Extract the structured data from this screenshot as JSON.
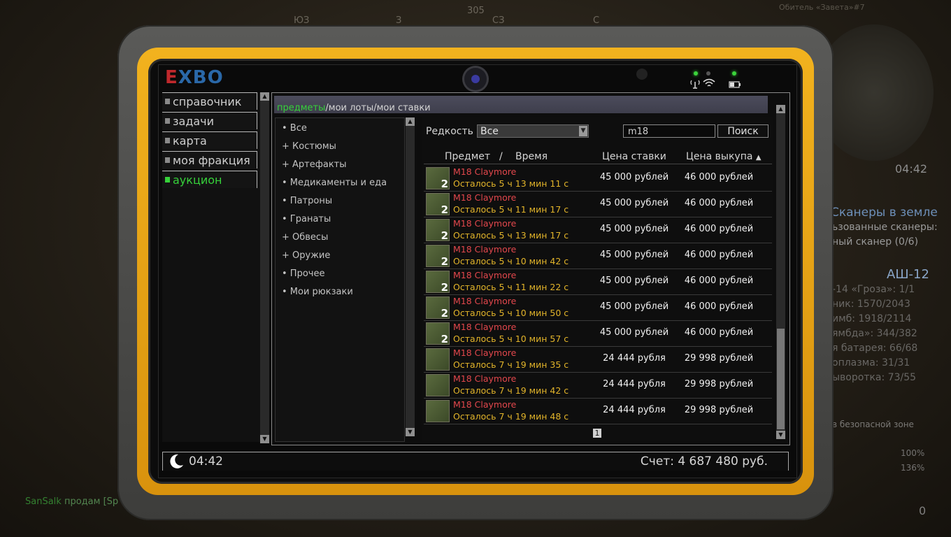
{
  "background": {
    "compass_marks": [
      "ЮЗ",
      "305",
      "З",
      "СЗ",
      "С"
    ],
    "location": "Обитель «Завета»#7",
    "hud_time": "04:42",
    "hud_quest_title": "Сканеры в земле",
    "hud_quest_lines": [
      "ьзованные сканеры:",
      "ный сканер (0/6)"
    ],
    "hud_weapon": "АШ-12",
    "hud_stats": [
      "-14 «Гроза»: 1/1",
      "ник: 1570/2043",
      "имб: 1918/2114",
      "ямбда»: 344/382",
      "я батарея: 66/68",
      "оплазма: 31/31",
      "ыворотка: 73/55"
    ],
    "hud_zone": "в безопасной зоне",
    "hud_bars": [
      "100%",
      "136%"
    ],
    "hud_count": "0",
    "chat_name": "SanSalk",
    "chat_text": "продам [Sp"
  },
  "tablet": {
    "logo_e": "E",
    "logo_rest": "XBO"
  },
  "nav": {
    "items": [
      {
        "label": "справочник"
      },
      {
        "label": "задачи"
      },
      {
        "label": "карта"
      },
      {
        "label": "моя фракция"
      },
      {
        "label": "аукцион"
      }
    ]
  },
  "tabs": {
    "active": "предметы",
    "items": [
      "мои лоты",
      "мои ставки"
    ],
    "separator": "/"
  },
  "categories": [
    "• Все",
    "+ Костюмы",
    "+ Артефакты",
    "• Медикаменты и еда",
    "• Патроны",
    "• Гранаты",
    "+ Обвесы",
    "+ Оружие",
    "• Прочее",
    "• Мои рюкзаки"
  ],
  "filters": {
    "rarity_label": "Редкость",
    "rarity_value": "Все",
    "search_value": "m18",
    "search_button": "Поиск"
  },
  "table": {
    "headers": {
      "item": "Предмет",
      "slash": "/",
      "time": "Время",
      "bid": "Цена ставки",
      "buyout": "Цена выкупа",
      "sort_arrow": "▲"
    },
    "rows": [
      {
        "name": "M18 Claymore",
        "qty": "2",
        "time": "Осталось 5 ч 13 мин 11 с",
        "bid": "45 000 рублей",
        "buyout": "46 000 рублей"
      },
      {
        "name": "M18 Claymore",
        "qty": "2",
        "time": "Осталось 5 ч 11 мин 17 с",
        "bid": "45 000 рублей",
        "buyout": "46 000 рублей"
      },
      {
        "name": "M18 Claymore",
        "qty": "2",
        "time": "Осталось 5 ч 13 мин 17 с",
        "bid": "45 000 рублей",
        "buyout": "46 000 рублей"
      },
      {
        "name": "M18 Claymore",
        "qty": "2",
        "time": "Осталось 5 ч 10 мин 42 с",
        "bid": "45 000 рублей",
        "buyout": "46 000 рублей"
      },
      {
        "name": "M18 Claymore",
        "qty": "2",
        "time": "Осталось 5 ч 11 мин 22 с",
        "bid": "45 000 рублей",
        "buyout": "46 000 рублей"
      },
      {
        "name": "M18 Claymore",
        "qty": "2",
        "time": "Осталось 5 ч 10 мин 50 с",
        "bid": "45 000 рублей",
        "buyout": "46 000 рублей"
      },
      {
        "name": "M18 Claymore",
        "qty": "2",
        "time": "Осталось 5 ч 10 мин 57 с",
        "bid": "45 000 рублей",
        "buyout": "46 000 рублей"
      },
      {
        "name": "M18 Claymore",
        "qty": "",
        "time": "Осталось 7 ч 19 мин 35 с",
        "bid": "24 444 рубля",
        "buyout": "29 998 рублей"
      },
      {
        "name": "M18 Claymore",
        "qty": "",
        "time": "Осталось 7 ч 19 мин 42 с",
        "bid": "24 444 рубля",
        "buyout": "29 998 рублей"
      },
      {
        "name": "M18 Claymore",
        "qty": "",
        "time": "Осталось 7 ч 19 мин 48 с",
        "bid": "24 444 рубля",
        "buyout": "29 998 рублей"
      }
    ],
    "page": "1"
  },
  "status": {
    "time": "04:42",
    "balance": "Счет: 4 687 480 руб."
  },
  "colors": {
    "accent_green": "#36d13a",
    "item_red": "#e2474c",
    "time_yellow": "#e2b42a",
    "frame_yellow": "#f2b21e"
  }
}
